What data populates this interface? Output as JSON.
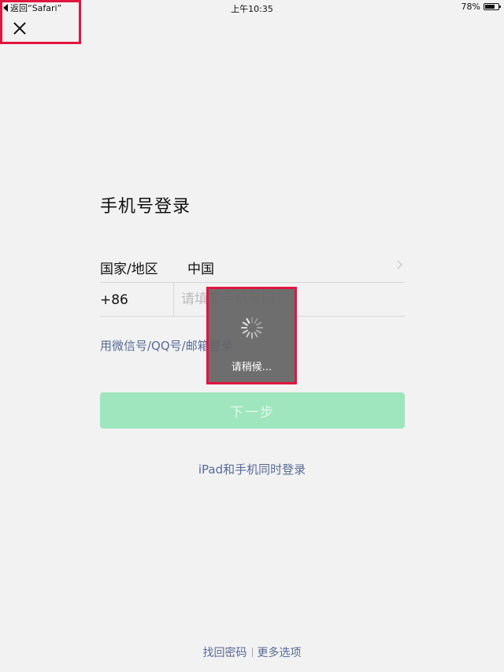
{
  "status_bar": {
    "back_label": "返回“Safari”",
    "time": "上午10:35",
    "battery": "78%",
    "battery_level": 0.78
  },
  "login": {
    "title": "手机号登录",
    "region_label": "国家/地区",
    "region_value": "中国",
    "country_code": "+86",
    "phone_placeholder": "请填写手机号码",
    "alt_login": "用微信号/QQ号/邮箱登录",
    "next_button": "下一步",
    "ipad_login": "iPad和手机同时登录"
  },
  "footer": {
    "recover": "找回密码",
    "more": "更多选项"
  },
  "toast": {
    "text": "请稍候..."
  },
  "colors": {
    "accent_link": "#576b95",
    "button_disabled": "#9fe6be",
    "highlight": "#e0163f"
  },
  "icons": [
    "back-triangle-icon",
    "battery-icon",
    "close-icon",
    "chevron-right-icon",
    "spinner-icon"
  ]
}
